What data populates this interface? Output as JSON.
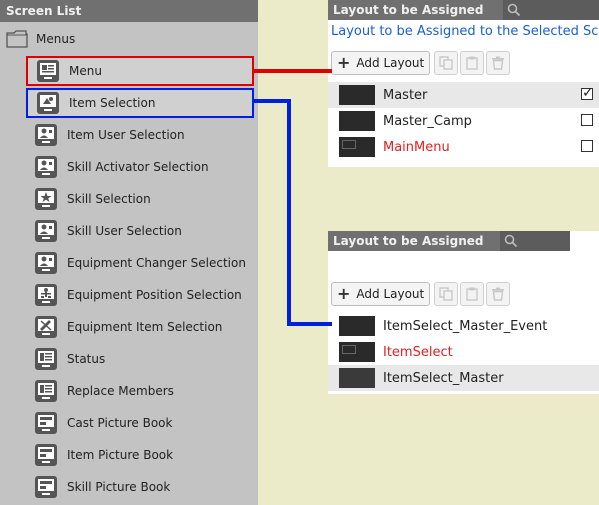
{
  "screen_list": {
    "title": "Screen List",
    "folder_label": "Menus",
    "items": [
      {
        "label": "Menu",
        "icon": "menu-screen-icon"
      },
      {
        "label": "Item Selection",
        "icon": "item-selection-icon"
      },
      {
        "label": "Item User Selection",
        "icon": "user-selection-icon"
      },
      {
        "label": "Skill Activator Selection",
        "icon": "user-selection-icon"
      },
      {
        "label": "Skill Selection",
        "icon": "skill-selection-icon"
      },
      {
        "label": "Skill User Selection",
        "icon": "user-selection-icon"
      },
      {
        "label": "Equipment Changer Selection",
        "icon": "user-selection-icon"
      },
      {
        "label": "Equipment Position Selection",
        "icon": "equipment-position-icon"
      },
      {
        "label": "Equipment Item Selection",
        "icon": "equipment-item-icon"
      },
      {
        "label": "Status",
        "icon": "status-icon"
      },
      {
        "label": "Replace Members",
        "icon": "status-icon"
      },
      {
        "label": "Cast Picture Book",
        "icon": "picture-book-icon"
      },
      {
        "label": "Item Picture Book",
        "icon": "picture-book-icon"
      },
      {
        "label": "Skill Picture Book",
        "icon": "picture-book-icon"
      }
    ]
  },
  "panel_top": {
    "title": "Layout to be Assigned",
    "subtitle": "Layout to be Assigned to the Selected Scre",
    "add_label": "Add Layout",
    "layouts": [
      {
        "name": "Master",
        "checked": true
      },
      {
        "name": "Master_Camp",
        "checked": false
      },
      {
        "name": "MainMenu",
        "checked": false
      }
    ]
  },
  "panel_bottom": {
    "title": "Layout to be Assigned",
    "add_label": "Add Layout",
    "layouts": [
      {
        "name": "ItemSelect_Master_Event"
      },
      {
        "name": "ItemSelect"
      },
      {
        "name": "ItemSelect_Master"
      }
    ]
  },
  "colors": {
    "red_highlight": "#e00000",
    "blue_highlight": "#0020e0",
    "link_text_blue": "#1a5fd0",
    "red_layout_text": "#e02020"
  }
}
